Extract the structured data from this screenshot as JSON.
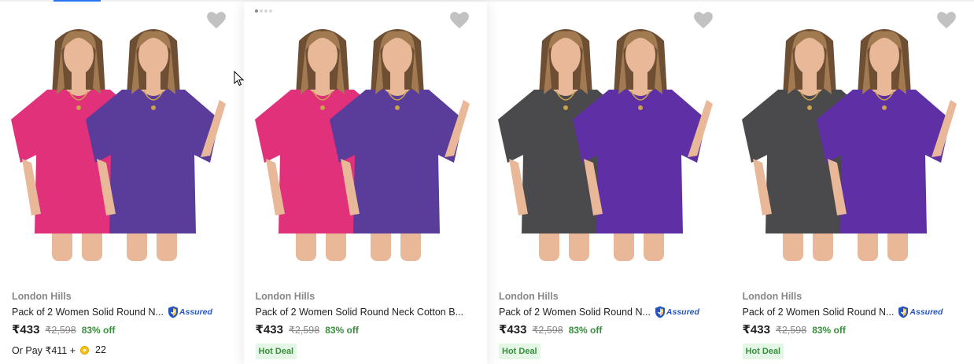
{
  "colors": {
    "accent": "#2874f0",
    "brand_grey": "#878787",
    "discount_green": "#388e3c",
    "hot_deal_bg": "#e4f7e6",
    "assured_blue": "#2455c3"
  },
  "products": [
    {
      "brand": "London Hills",
      "title": "Pack of 2 Women Solid Round N...",
      "assured": true,
      "assured_label": "Assured",
      "price": "₹433",
      "mrp": "₹2,598",
      "discount": "83% off",
      "pay_prefix": "Or Pay ₹411 +",
      "coins": "22",
      "shirt_colors": [
        "#e0317a",
        "#5a3c9a"
      ],
      "wishlist_icon": "heart-icon"
    },
    {
      "brand": "London Hills",
      "title": "Pack of 2 Women Solid Round Neck Cotton B...",
      "assured": false,
      "price": "₹433",
      "mrp": "₹2,598",
      "discount": "83% off",
      "badge": "Hot Deal",
      "shirt_colors": [
        "#e0317a",
        "#5a3c9a"
      ],
      "wishlist_icon": "heart-icon"
    },
    {
      "brand": "London Hills",
      "title": "Pack of 2 Women Solid Round N...",
      "assured": true,
      "assured_label": "Assured",
      "price": "₹433",
      "mrp": "₹2,598",
      "discount": "83% off",
      "badge": "Hot Deal",
      "shirt_colors": [
        "#4a4a4c",
        "#5f2fa6"
      ],
      "wishlist_icon": "heart-icon"
    },
    {
      "brand": "London Hills",
      "title": "Pack of 2 Women Solid Round N...",
      "assured": true,
      "assured_label": "Assured",
      "price": "₹433",
      "mrp": "₹2,598",
      "discount": "83% off",
      "badge": "Hot Deal",
      "shirt_colors": [
        "#4a4a4c",
        "#5f2fa6"
      ],
      "wishlist_icon": "heart-icon"
    }
  ]
}
